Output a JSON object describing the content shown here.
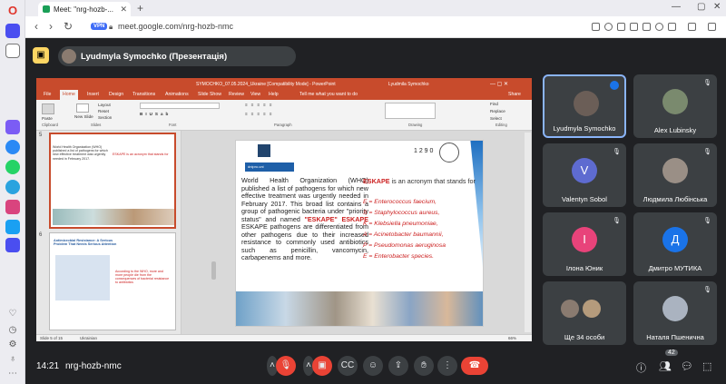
{
  "browser": {
    "tab_title": "Meet: \"nrg-hozb-...",
    "tab_close": "✕",
    "new_tab": "+",
    "url": "meet.google.com/nrg-hozb-nmc",
    "vpn_label": "VPN",
    "window_controls": [
      "—",
      "▢",
      "✕"
    ]
  },
  "presenter": {
    "name": "Lyudmyla Symochko (Презентація)"
  },
  "ppt": {
    "title_bar": "SYMOCHKO_07.05.2024_Ukraine [Compatibility Mode] - PowerPoint",
    "user": "Lyudmila Symochko",
    "tabs": [
      "File",
      "Home",
      "Insert",
      "Design",
      "Transitions",
      "Animations",
      "Slide Show",
      "Review",
      "View",
      "Help"
    ],
    "tell_me": "Tell me what you want to do",
    "share": "Share",
    "ribbon_groups": [
      "Clipboard",
      "Slides",
      "Font",
      "Paragraph",
      "Drawing",
      "Editing"
    ],
    "ribbon_buttons": {
      "paste": "Paste",
      "new_slide": "New Slide",
      "layout": "Layout",
      "reset": "Reset",
      "section": "Section",
      "find": "Find",
      "replace": "Replace",
      "select": "Select"
    },
    "thumb_numbers": [
      "5",
      "6"
    ],
    "thumb5_left": "World Health Organization (WHO) published a list of pathogens for which new effective treatment was urgently needed in February 2017.",
    "thumb5_right": "ESKAPE is an acronym that stands for",
    "thumb6_title": "Antimicrobial Resistance: A Serious Problem That Needs Serious Attention",
    "thumb6_right": "According to the WHO, more and more people die from the consequences of bacterial resistance to antibiotics",
    "status_left": "Slide 5 of 15",
    "status_lang": "Ukrainian",
    "zoom": "66%",
    "slide": {
      "logo_text": "dnipro.uni",
      "corner_numbers": "1 2    9 0",
      "left_text_1": "World Health Organization (WHO) published a list of pathogens for which new effective treatment was urgently needed in February 2017. This broad list contains a group of pathogenic bacteria under \"priority status\" and named ",
      "left_highlight": "\"ESKAPE\"",
      "left_text_2": "ESKAPE pathogens are differentiated from other pathogens due to their increased resistance to commonly used antibiotics such as penicillin, vancomycin, carbapenems and more.",
      "right_title_a": "ESKAPE",
      "right_title_b": " is an acronym that stands for",
      "bacteria": [
        "E = Enterococcus faecium,",
        "S = Staphylococcus aureus,",
        "K = Klebsiella pneumoniae,",
        "A = Acinetobacter baumannii,",
        "P = Pseudomonas aeruginosa",
        "E = Enterobacter species."
      ]
    }
  },
  "participants": [
    {
      "name": "Lyudmyla Symochko",
      "initial": "",
      "color": "#6b5e57",
      "active": true
    },
    {
      "name": "Alex Lubinsky",
      "initial": "",
      "color": "#7a8a6e",
      "active": false
    },
    {
      "name": "Valentyn Sobol",
      "initial": "V",
      "color": "#5e6bd0",
      "active": false
    },
    {
      "name": "Людмила Любінська",
      "initial": "",
      "color": "#9a8f86",
      "active": false
    },
    {
      "name": "Ілона Юник",
      "initial": "І",
      "color": "#e8437a",
      "active": false
    },
    {
      "name": "Дмитро МУТИКА",
      "initial": "Д",
      "color": "#1a73e8",
      "active": false
    },
    {
      "name": "Ще 34 особи",
      "initial": "",
      "color": "#8a7b70",
      "active": false
    },
    {
      "name": "Наталя Пшенична",
      "initial": "",
      "color": "#aab3c0",
      "active": false
    }
  ],
  "meeting": {
    "time": "14:21",
    "code": "nrg-hozb-nmc",
    "people_count": "42"
  },
  "colors": {
    "meet_bg": "#202124",
    "tile_bg": "#3c4043",
    "ppt_accent": "#c84b2c",
    "leave_red": "#ea4335",
    "slide_red": "#cc2020"
  }
}
